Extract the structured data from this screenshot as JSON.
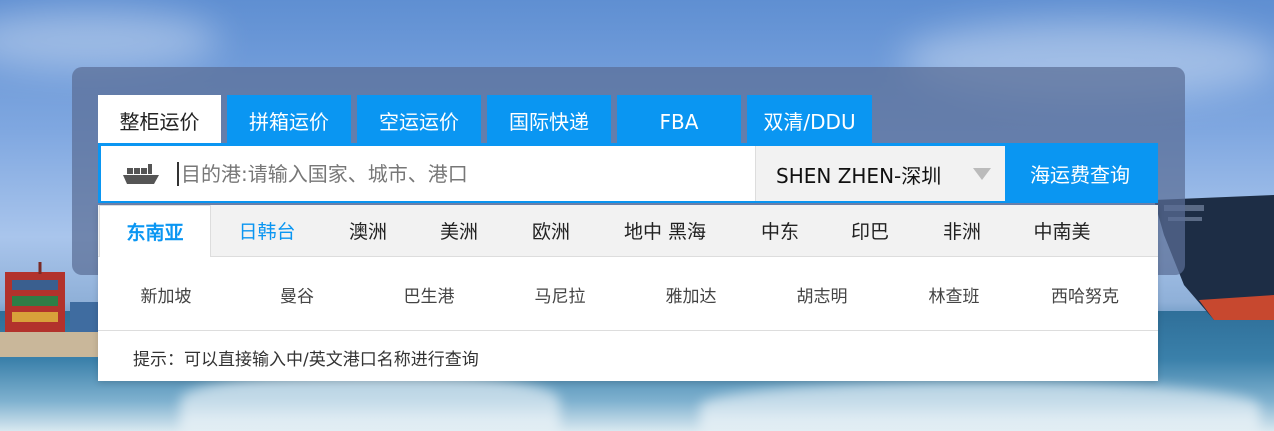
{
  "tabs": [
    {
      "label": "整柜运价",
      "active": true
    },
    {
      "label": "拼箱运价",
      "active": false
    },
    {
      "label": "空运运价",
      "active": false
    },
    {
      "label": "国际快递",
      "active": false
    },
    {
      "label": "FBA",
      "active": false
    },
    {
      "label": "双清/DDU",
      "active": false
    }
  ],
  "search": {
    "icon": "cargo-ship-icon",
    "placeholder": "目的港:请输入国家、城市、港口",
    "value": ""
  },
  "origin": {
    "selected": "SHEN ZHEN-深圳"
  },
  "query_button": "海运费查询",
  "regions": [
    {
      "label": "东南亚",
      "state": "active"
    },
    {
      "label": "日韩台",
      "state": "alt"
    },
    {
      "label": "澳洲",
      "state": "normal"
    },
    {
      "label": "美洲",
      "state": "normal"
    },
    {
      "label": "欧洲",
      "state": "normal"
    },
    {
      "label": "地中 黑海",
      "state": "normal"
    },
    {
      "label": "中东",
      "state": "normal"
    },
    {
      "label": "印巴",
      "state": "normal"
    },
    {
      "label": "非洲",
      "state": "normal"
    },
    {
      "label": "中南美",
      "state": "normal"
    }
  ],
  "ports": [
    "新加坡",
    "曼谷",
    "巴生港",
    "马尼拉",
    "雅加达",
    "胡志明",
    "林查班",
    "西哈努克"
  ],
  "hint": "提示：可以直接输入中/英文港口名称进行查询",
  "colors": {
    "accent": "#0a96f2",
    "panel": "#5a6e96"
  }
}
